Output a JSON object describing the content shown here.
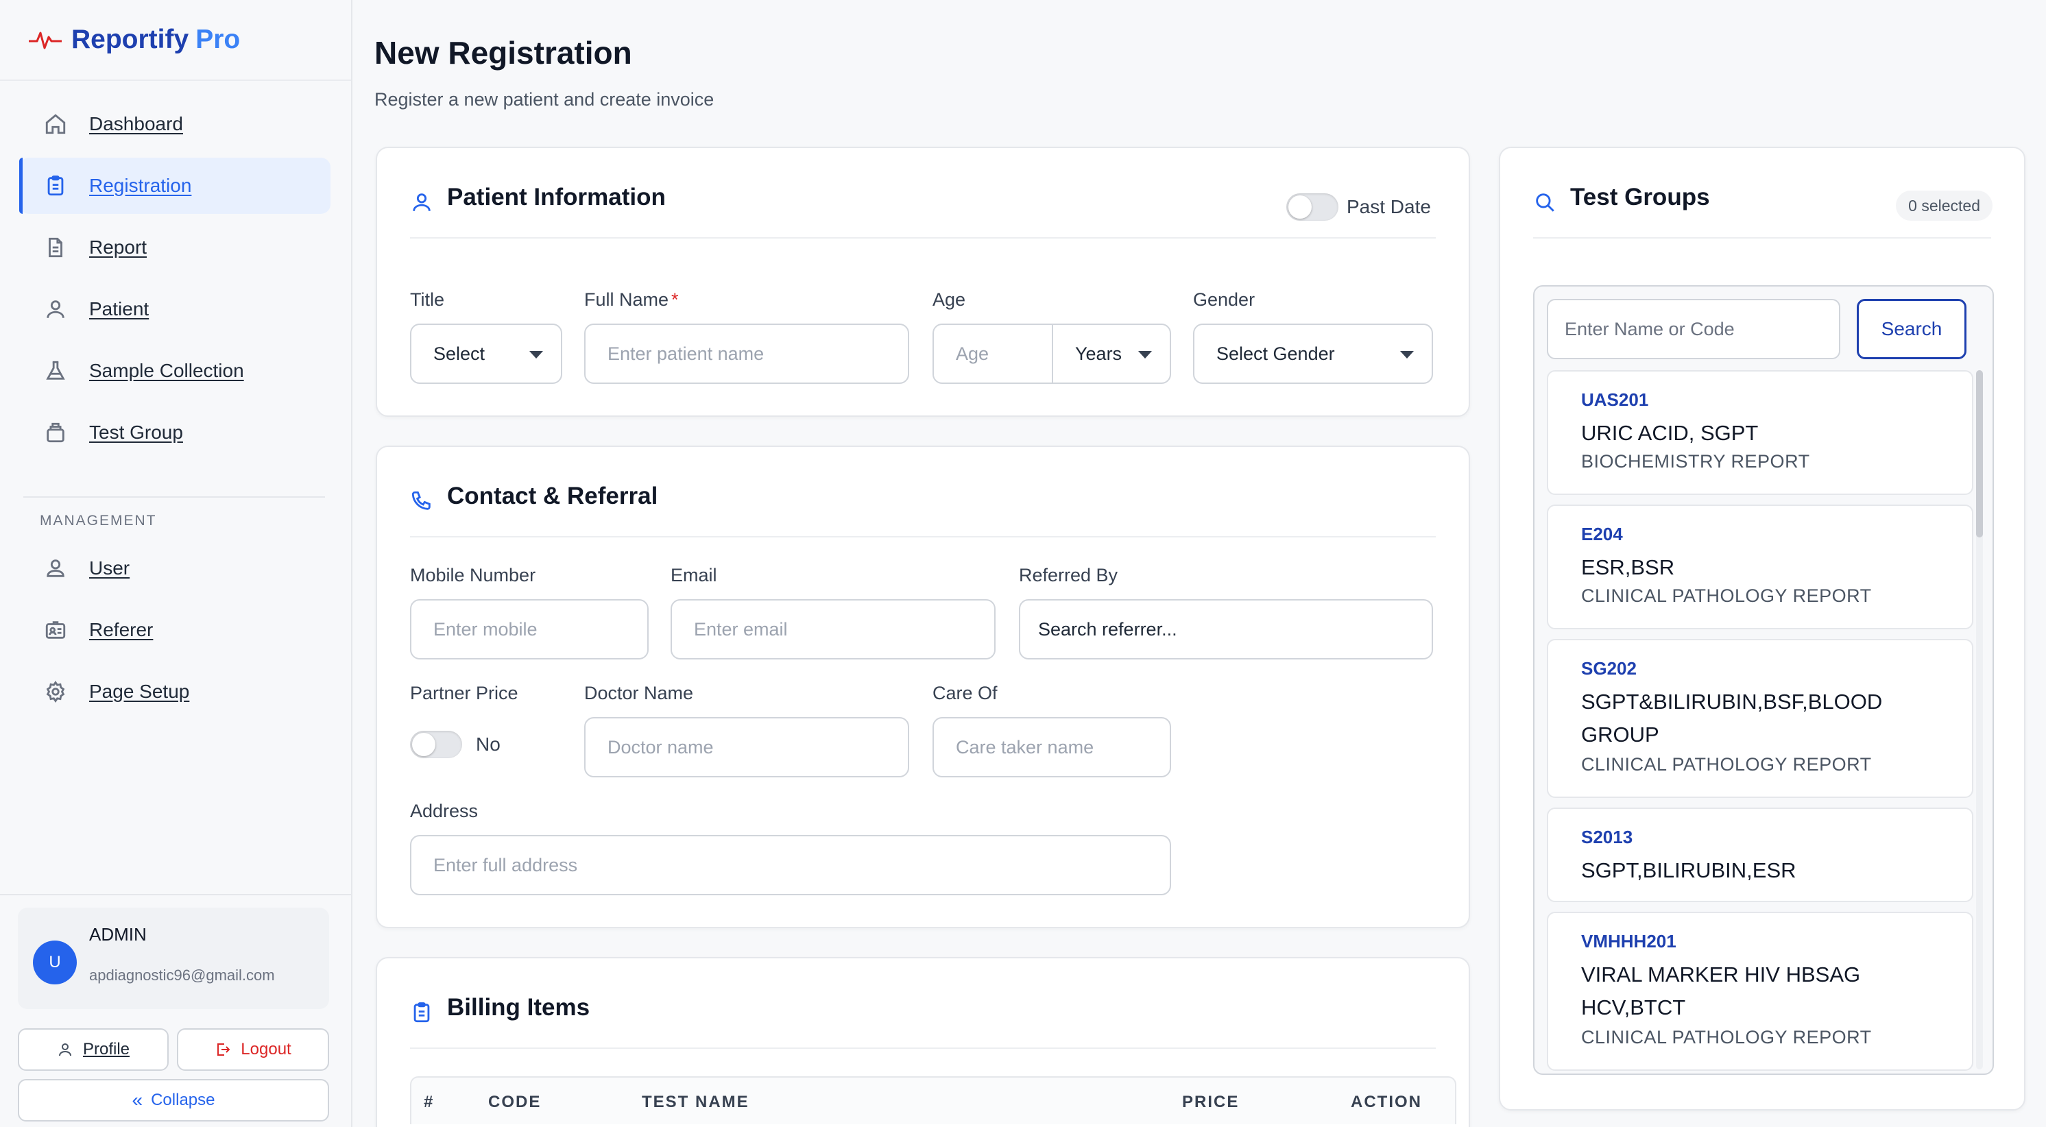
{
  "brand": {
    "name": "Reportify",
    "suffix": "Pro",
    "accent": "#1e40af",
    "accent_light": "#3b82f6"
  },
  "sidebar": {
    "items": [
      {
        "label": "Dashboard",
        "icon": "home-icon"
      },
      {
        "label": "Registration",
        "icon": "clipboard-icon",
        "active": true
      },
      {
        "label": "Report",
        "icon": "document-icon"
      },
      {
        "label": "Patient",
        "icon": "user-icon"
      },
      {
        "label": "Sample Collection",
        "icon": "flask-icon"
      },
      {
        "label": "Test Group",
        "icon": "layers-icon"
      }
    ],
    "section_label": "MANAGEMENT",
    "management": [
      {
        "label": "User",
        "icon": "users-icon"
      },
      {
        "label": "Referer",
        "icon": "id-card-icon"
      },
      {
        "label": "Page Setup",
        "icon": "gear-icon"
      }
    ],
    "user": {
      "initial": "U",
      "name": "ADMIN",
      "email": "apdiagnostic96@gmail.com"
    },
    "profile_label": "Profile",
    "logout_label": "Logout",
    "collapse_label": "Collapse"
  },
  "page": {
    "title": "New Registration",
    "subtitle": "Register a new patient and create invoice"
  },
  "patient": {
    "heading": "Patient Information",
    "past_date_label": "Past Date",
    "title_label": "Title",
    "title_value": "Select",
    "fullname_label": "Full Name",
    "fullname_required": "*",
    "fullname_placeholder": "Enter patient name",
    "age_label": "Age",
    "age_placeholder": "Age",
    "age_unit": "Years",
    "gender_label": "Gender",
    "gender_value": "Select Gender"
  },
  "contact": {
    "heading": "Contact & Referral",
    "mobile_label": "Mobile Number",
    "mobile_placeholder": "Enter mobile",
    "email_label": "Email",
    "email_placeholder": "Enter email",
    "referred_label": "Referred By",
    "referred_placeholder": "Search referrer...",
    "partner_label": "Partner Price",
    "partner_value": "No",
    "doctor_label": "Doctor Name",
    "doctor_placeholder": "Doctor name",
    "careof_label": "Care Of",
    "careof_placeholder": "Care taker name",
    "address_label": "Address",
    "address_placeholder": "Enter full address"
  },
  "billing": {
    "heading": "Billing Items",
    "columns": [
      "#",
      "CODE",
      "TEST NAME",
      "PRICE",
      "ACTION"
    ]
  },
  "test_groups": {
    "heading": "Test Groups",
    "selected_badge": "0 selected",
    "search_placeholder": "Enter Name or Code",
    "search_button": "Search",
    "items": [
      {
        "code": "UAS201",
        "name": "URIC ACID, SGPT",
        "category": "BIOCHEMISTRY REPORT"
      },
      {
        "code": "E204",
        "name": "ESR,BSR",
        "category": "CLINICAL PATHOLOGY REPORT"
      },
      {
        "code": "SG202",
        "name": "SGPT&BILIRUBIN,BSF,BLOOD GROUP",
        "category": "CLINICAL PATHOLOGY REPORT"
      },
      {
        "code": "S2013",
        "name": "SGPT,BILIRUBIN,ESR",
        "category": ""
      },
      {
        "code": "VMHHH201",
        "name": "VIRAL MARKER HIV HBSAG HCV,BTCT",
        "category": "CLINICAL PATHOLOGY REPORT"
      }
    ]
  }
}
